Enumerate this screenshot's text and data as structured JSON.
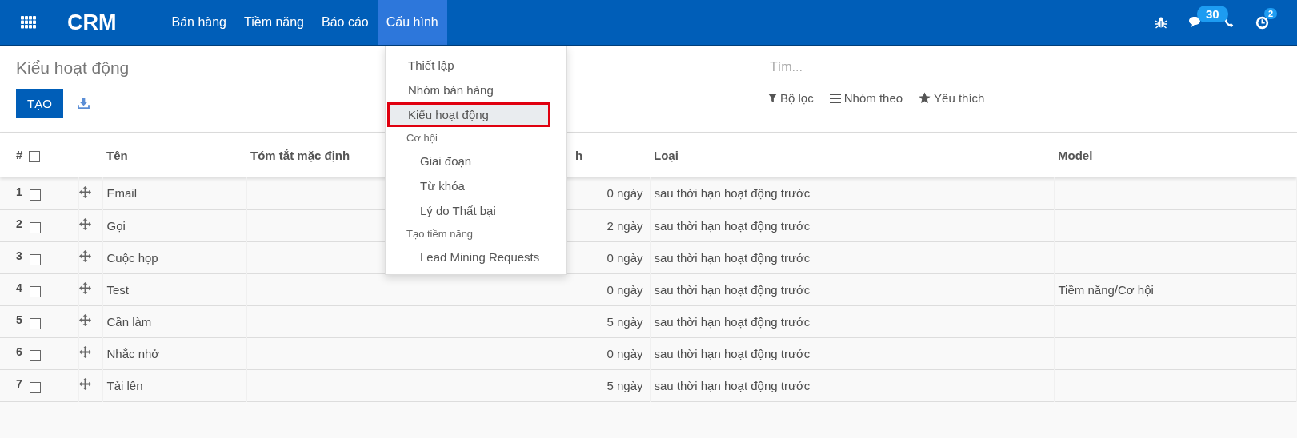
{
  "navbar": {
    "app_name": "CRM",
    "menu": [
      {
        "label": "Bán hàng",
        "selected": false
      },
      {
        "label": "Tiềm năng",
        "selected": false
      },
      {
        "label": "Báo cáo",
        "selected": false
      },
      {
        "label": "Cấu hình",
        "selected": true
      }
    ],
    "messages_count": "30",
    "activities_count": "2"
  },
  "control_panel": {
    "title": "Kiểu hoạt động",
    "create_button": "TẠO",
    "search": {
      "placeholder": "Tìm..."
    },
    "filters": [
      {
        "kind": "filter",
        "label": "Bộ lọc"
      },
      {
        "kind": "group",
        "label": "Nhóm theo"
      },
      {
        "kind": "favorite",
        "label": "Yêu thích"
      }
    ]
  },
  "dropdown": [
    {
      "kind": "item",
      "label": "Thiết lập",
      "selected": false
    },
    {
      "kind": "item",
      "label": "Nhóm bán hàng",
      "selected": false
    },
    {
      "kind": "item",
      "label": "Kiểu hoạt động",
      "selected": true
    },
    {
      "kind": "section",
      "label": "Cơ hội"
    },
    {
      "kind": "subitem",
      "label": "Giai đoạn",
      "selected": false
    },
    {
      "kind": "subitem",
      "label": "Từ khóa",
      "selected": false
    },
    {
      "kind": "subitem",
      "label": "Lý do Thất bại",
      "selected": false
    },
    {
      "kind": "section",
      "label": "Tạo tiềm năng"
    },
    {
      "kind": "subitem",
      "label": "Lead Mining Requests",
      "selected": false
    }
  ],
  "table": {
    "header_checked": false,
    "columns": [
      "#",
      "Tên",
      "Tóm tắt mặc định",
      "h",
      "Loại",
      "Model"
    ],
    "rows": [
      {
        "number": "1",
        "checked": false,
        "name": "Email",
        "column_3": "0 ngày",
        "type": "sau thời hạn hoạt động trước"
      },
      {
        "number": "2",
        "checked": false,
        "name": "Gọi",
        "column_3": "2 ngày",
        "type": "sau thời hạn hoạt động trước"
      },
      {
        "number": "3",
        "checked": false,
        "name": "Cuộc họp",
        "column_3": "0 ngày",
        "type": "sau thời hạn hoạt động trước"
      },
      {
        "number": "4",
        "checked": false,
        "name": "Test",
        "column_3": "0 ngày",
        "type": "sau thời hạn hoạt động trước",
        "model": "Tiềm năng/Cơ hội"
      },
      {
        "number": "5",
        "checked": false,
        "name": "Cần làm",
        "column_3": "5 ngày",
        "type": "sau thời hạn hoạt động trước"
      },
      {
        "number": "6",
        "checked": false,
        "name": "Nhắc nhở",
        "column_3": "0 ngày",
        "type": "sau thời hạn hoạt động trước"
      },
      {
        "number": "7",
        "checked": false,
        "name": "Tải lên",
        "column_3": "5 ngày",
        "type": "sau thời hạn hoạt động trước"
      }
    ]
  }
}
